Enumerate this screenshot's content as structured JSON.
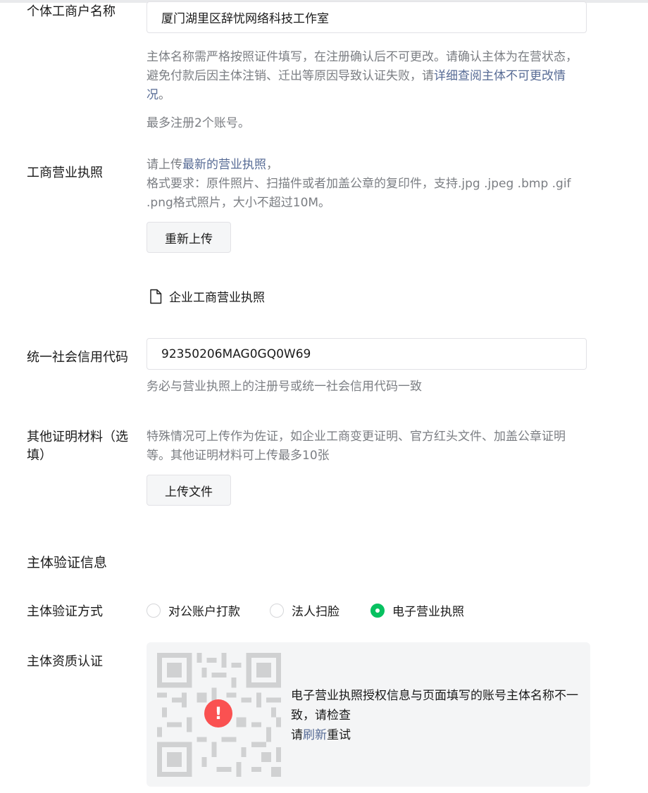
{
  "entity_name": {
    "label": "个体工商户名称",
    "value": "厦门湖里区辞忧网络科技工作室",
    "hint_prefix": "主体名称需严格按照证件填写，在注册确认后不可更改。请确认主体为在营状态，避免付款后因主体注销、迁出等原因导致认证失败，请",
    "hint_link": "详细查阅主体不可更改情况",
    "hint_suffix": "。",
    "limit_text": "最多注册2个账号。"
  },
  "business_license": {
    "label": "工商营业执照",
    "hint_line1_prefix": "请上传",
    "hint_line1_link": "最新的营业执照",
    "hint_line1_suffix": "，",
    "hint_line2": "格式要求：原件照片、扫描件或者加盖公章的复印件，支持.jpg .jpeg .bmp .gif .png格式照片，大小不超过10M。",
    "reupload_label": "重新上传",
    "file_name": "企业工商营业执照",
    "file_icon": "document-icon"
  },
  "credit_code": {
    "label": "统一社会信用代码",
    "value": "92350206MAG0GQ0W69",
    "hint": "务必与营业执照上的注册号或统一社会信用代码一致"
  },
  "other_materials": {
    "label": "其他证明材料（选填）",
    "hint": "特殊情况可上传作为佐证，如企业工商变更证明、官方红头文件、加盖公章证明等。其他证明材料可上传最多10张",
    "upload_label": "上传文件"
  },
  "verification": {
    "section_title": "主体验证信息",
    "method_label": "主体验证方式",
    "options": [
      {
        "label": "对公账户打款",
        "checked": false
      },
      {
        "label": "法人扫脸",
        "checked": false
      },
      {
        "label": "电子营业执照",
        "checked": true
      }
    ],
    "qualification_label": "主体资质认证",
    "error_line1": "电子营业执照授权信息与页面填写的账号主体名称不一致，请检查",
    "error_line2_prefix": "请",
    "error_line2_link": "刷新",
    "error_line2_suffix": "重试",
    "alert_icon": "exclamation-icon"
  },
  "colors": {
    "accent_green": "#07c160",
    "link": "#576b95",
    "error_red": "#fa5151",
    "hint_gray": "#7b7e83"
  }
}
